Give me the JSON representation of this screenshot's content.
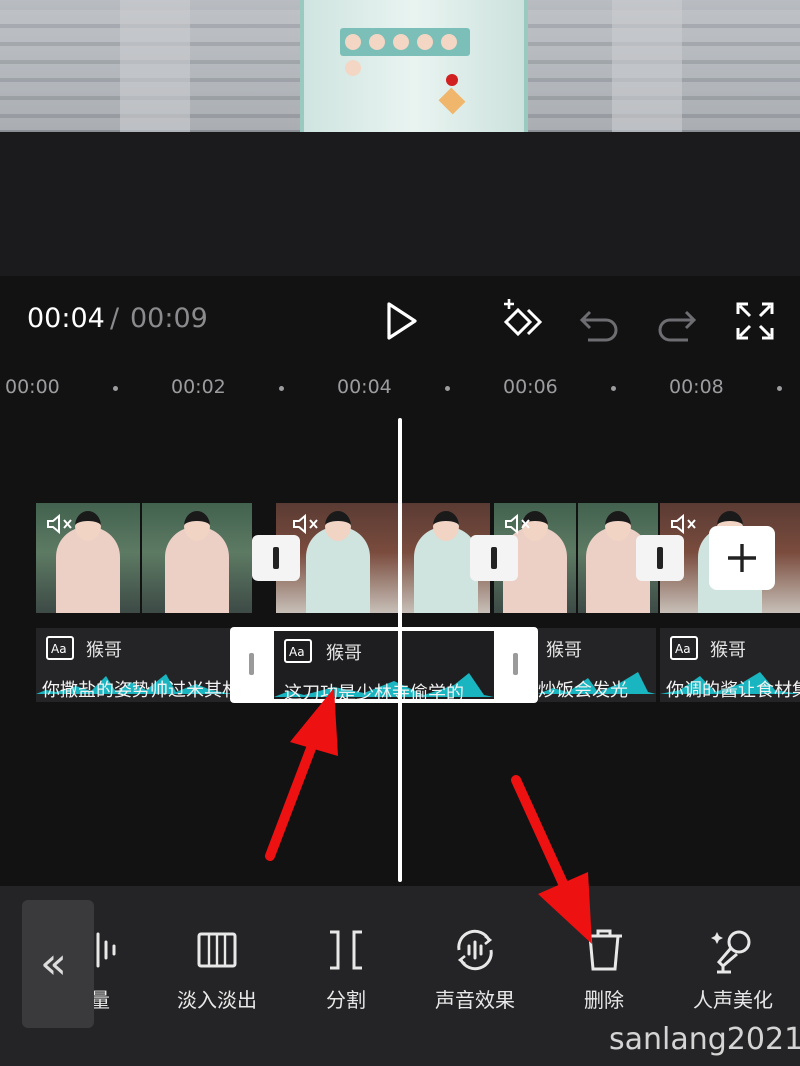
{
  "player": {
    "current_time": "00:04",
    "separator": "/",
    "total_time": "00:09"
  },
  "ruler": {
    "ticks": [
      "00:00",
      "00:02",
      "00:04",
      "00:06",
      "00:08"
    ]
  },
  "text_tracks": [
    {
      "speaker": "猴哥",
      "caption": "你撒盐的姿势帅过米其林"
    },
    {
      "speaker": "猴哥",
      "caption": "这刀功是少林寺偷学的"
    },
    {
      "speaker": "猴哥",
      "caption": "炒饭会发光"
    },
    {
      "speaker": "猴哥",
      "caption": "你调的酱让食材集"
    }
  ],
  "toolbar": {
    "back_label": "«",
    "items": [
      {
        "label": "量",
        "icon": "volume-icon"
      },
      {
        "label": "淡入淡出",
        "icon": "fade-icon"
      },
      {
        "label": "分割",
        "icon": "split-icon"
      },
      {
        "label": "声音效果",
        "icon": "sound-effect-icon"
      },
      {
        "label": "删除",
        "icon": "trash-icon"
      },
      {
        "label": "人声美化",
        "icon": "voice-beautify-icon"
      }
    ]
  },
  "watermark": "sanlang2021",
  "colors": {
    "accent_wave": "#19b5c0",
    "annotation_arrow": "#ee1111"
  }
}
